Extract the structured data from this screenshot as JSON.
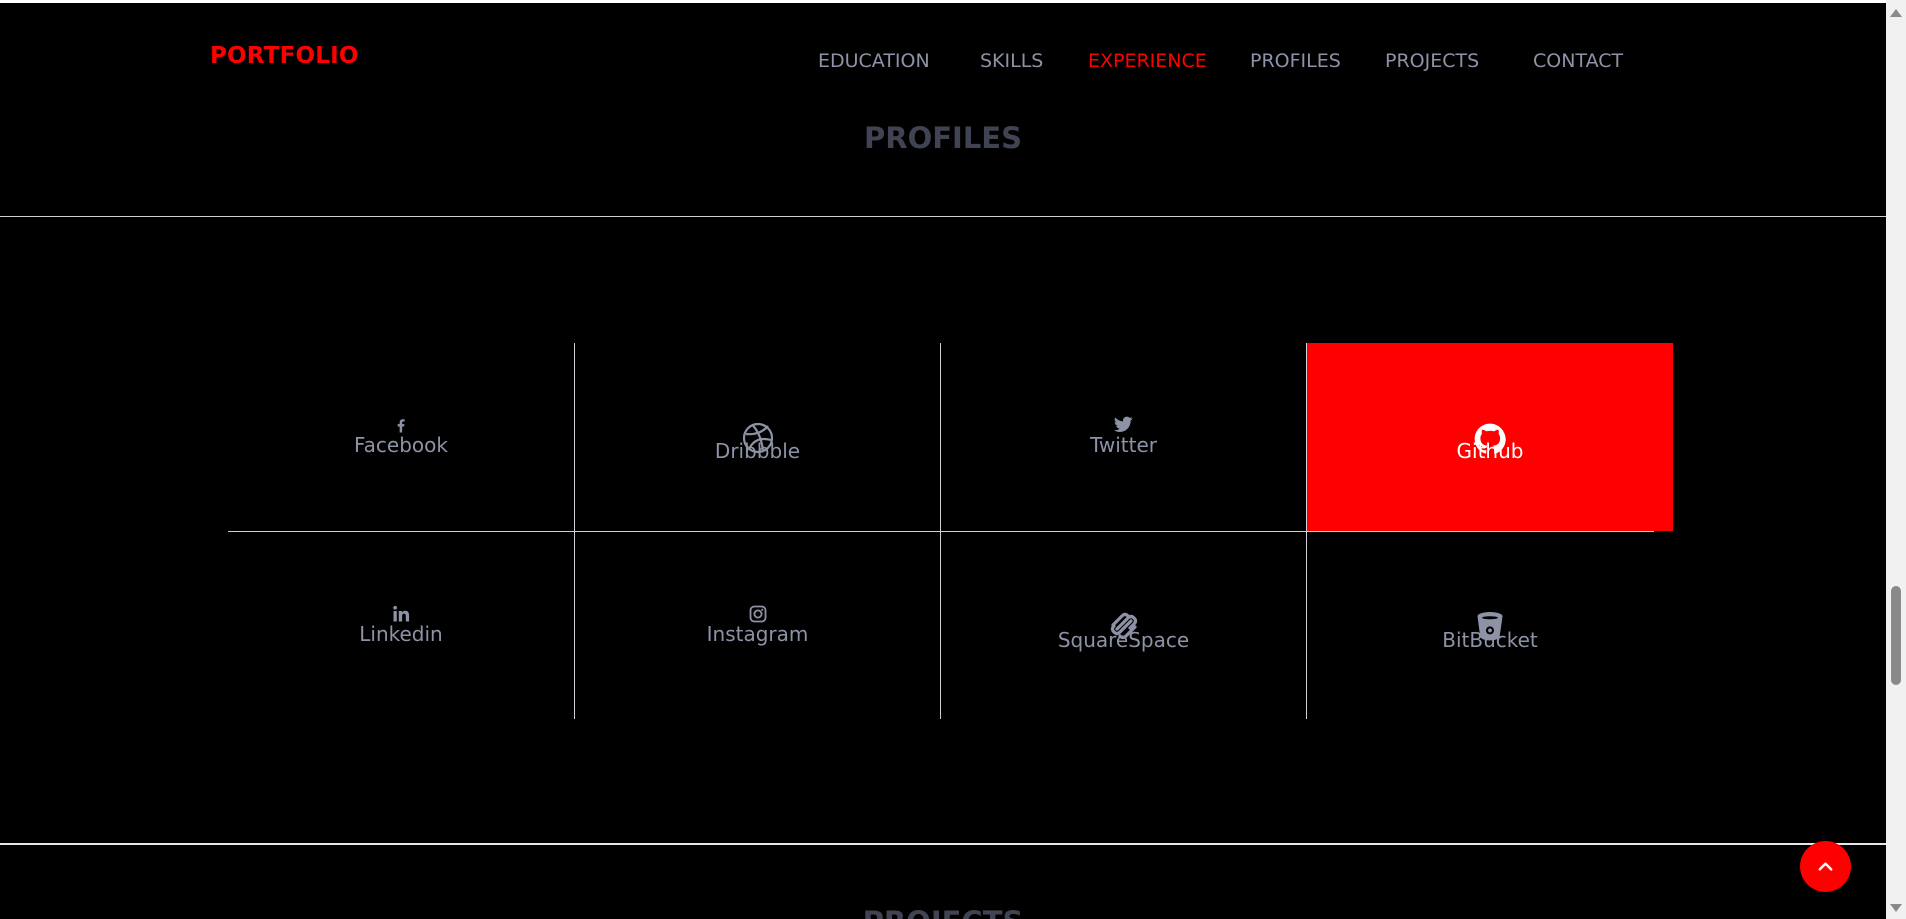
{
  "header": {
    "brand": "PORTFOLIO",
    "nav": [
      {
        "label": "EDUCATION",
        "active": false
      },
      {
        "label": "SKILLS",
        "active": false
      },
      {
        "label": "EXPERIENCE",
        "active": true
      },
      {
        "label": "PROFILES",
        "active": false
      },
      {
        "label": "PROJECTS",
        "active": false
      },
      {
        "label": "CONTACT",
        "active": false
      }
    ]
  },
  "section": {
    "title": "PROFILES"
  },
  "profiles": [
    {
      "label": "Facebook",
      "icon": "facebook-icon",
      "active": false
    },
    {
      "label": "Dribbble",
      "icon": "dribbble-icon",
      "active": false
    },
    {
      "label": "Twitter",
      "icon": "twitter-icon",
      "active": false
    },
    {
      "label": "Github",
      "icon": "github-icon",
      "active": true
    },
    {
      "label": "Linkedin",
      "icon": "linkedin-icon",
      "active": false
    },
    {
      "label": "Instagram",
      "icon": "instagram-icon",
      "active": false
    },
    {
      "label": "SquareSpace",
      "icon": "squarespace-icon",
      "active": false
    },
    {
      "label": "BitBucket",
      "icon": "bitbucket-icon",
      "active": false
    }
  ],
  "next_section": {
    "title": "PROJECTS"
  },
  "back_to_top": {
    "icon": "chevron-up-icon"
  },
  "colors": {
    "accent": "#ff0000",
    "background": "#000000",
    "muted_text": "#8e92a6",
    "heading": "#3f4352"
  }
}
